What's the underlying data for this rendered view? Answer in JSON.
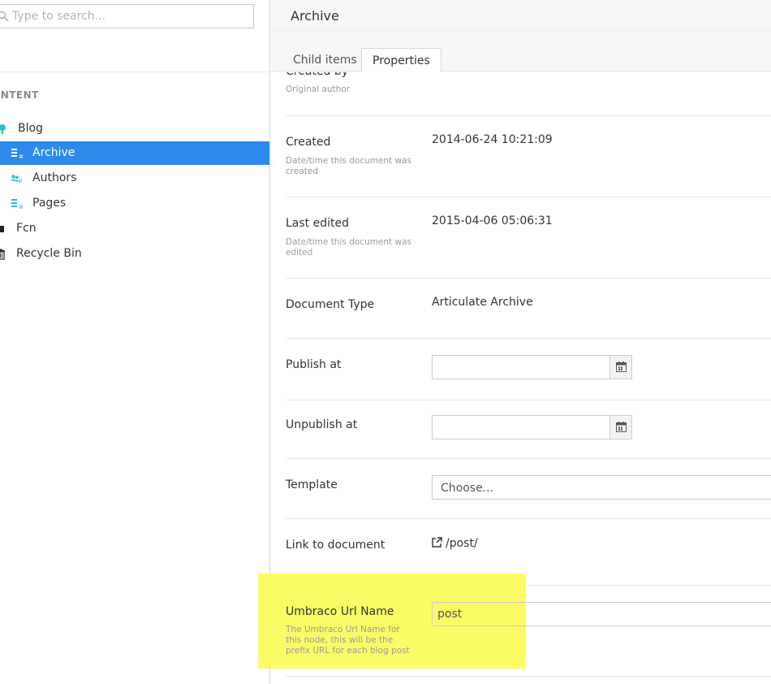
{
  "search": {
    "placeholder": "Type to search..."
  },
  "sidebar": {
    "section_header": "ONTENT",
    "items": [
      {
        "label": "Blog",
        "icon": "blog-icon"
      },
      {
        "label": "Archive",
        "icon": "list-icon",
        "selected": true
      },
      {
        "label": "Authors",
        "icon": "users-icon"
      },
      {
        "label": "Pages",
        "icon": "list-icon"
      },
      {
        "label": "Fcn",
        "icon": "folder-icon"
      },
      {
        "label": "Recycle Bin",
        "icon": "trash-icon"
      }
    ]
  },
  "header": {
    "title": "Archive"
  },
  "tabs": [
    {
      "label": "Child items",
      "active": false
    },
    {
      "label": "Properties",
      "active": true
    }
  ],
  "properties": {
    "created_by": {
      "label": "Created by",
      "description": "Original author"
    },
    "created": {
      "label": "Created",
      "description": "Date/time this document was created",
      "value": "2014-06-24 10:21:09"
    },
    "last_edited": {
      "label": "Last edited",
      "description": "Date/time this document was edited",
      "value": "2015-04-06 05:06:31"
    },
    "document_type": {
      "label": "Document Type",
      "value": "Articulate Archive"
    },
    "publish_at": {
      "label": "Publish at",
      "value": ""
    },
    "unpublish_at": {
      "label": "Unpublish at",
      "value": ""
    },
    "template": {
      "label": "Template",
      "value": "Choose..."
    },
    "link": {
      "label": "Link to document",
      "value": "/post/"
    },
    "url_name": {
      "label": "Umbraco Url Name",
      "description": "The Umbraco Url Name for this node, this will be the prefix URL for each blog post",
      "value": "post"
    }
  },
  "colors": {
    "accent": "#2e8aea",
    "highlight": "#fafa4a",
    "teal": "#2bc0c4"
  }
}
